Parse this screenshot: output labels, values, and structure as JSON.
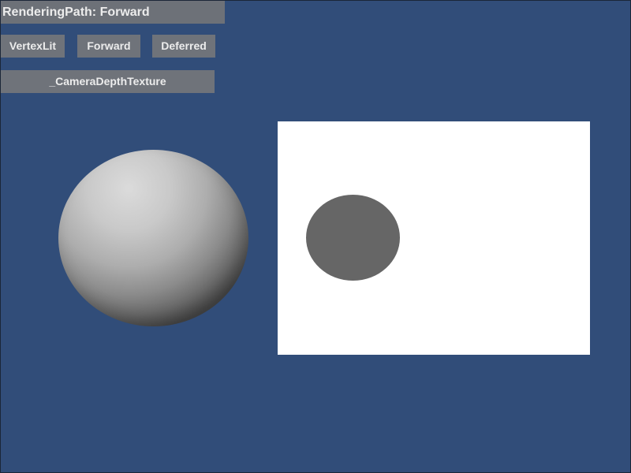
{
  "window": {
    "background_color": "#314d79"
  },
  "gui": {
    "rendering_path_label": "RenderingPath: Forward",
    "buttons": {
      "vertexlit": "VertexLit",
      "forward": "Forward",
      "deferred": "Deferred",
      "depth_texture": "_CameraDepthTexture"
    }
  },
  "scene": {
    "sphere_color": "#d8d8d8",
    "depth_preview_background": "#ffffff",
    "depth_preview_object_color": "#666666"
  }
}
